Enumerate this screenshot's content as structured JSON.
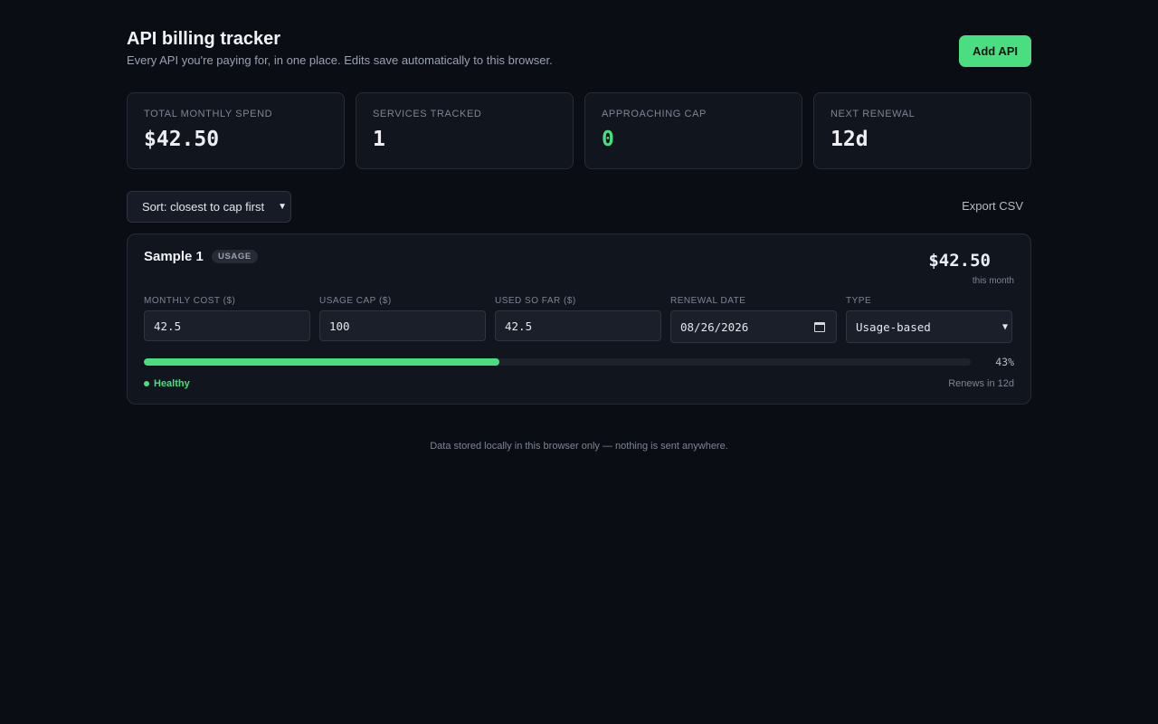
{
  "header": {
    "title": "API billing tracker",
    "subtitle": "Every API you're paying for, in one place. Edits save automatically to this browser.",
    "add_button": "Add API",
    "accent_color": "#4ade80"
  },
  "stats": [
    {
      "label": "TOTAL MONTHLY SPEND",
      "value": "$42.50"
    },
    {
      "label": "SERVICES TRACKED",
      "value": "1"
    },
    {
      "label": "APPROACHING CAP",
      "value": "0"
    },
    {
      "label": "NEXT RENEWAL",
      "value": "12d"
    }
  ],
  "toolbar": {
    "sort_value": "Sort: closest to cap first",
    "export_label": "Export CSV"
  },
  "services": [
    {
      "name": "Sample 1",
      "badge": "USAGE",
      "amount": "$42.50",
      "period": "this month",
      "fields": {
        "monthly_cost": {
          "label": "MONTHLY COST ($)",
          "value": "42.5"
        },
        "usage_cap": {
          "label": "USAGE CAP ($)",
          "value": "100"
        },
        "used_so_far": {
          "label": "USED SO FAR ($)",
          "value": "42.5"
        },
        "renewal_date": {
          "label": "RENEWAL DATE",
          "value": "08/26/2026"
        },
        "type": {
          "label": "TYPE",
          "value": "Usage-based"
        }
      },
      "progress_percent": 43,
      "progress_label": "43%",
      "status": "Healthy",
      "status_color": "#4ade80",
      "renews": "Renews in 12d"
    }
  ],
  "footer": "Data stored locally in this browser only — nothing is sent anywhere."
}
